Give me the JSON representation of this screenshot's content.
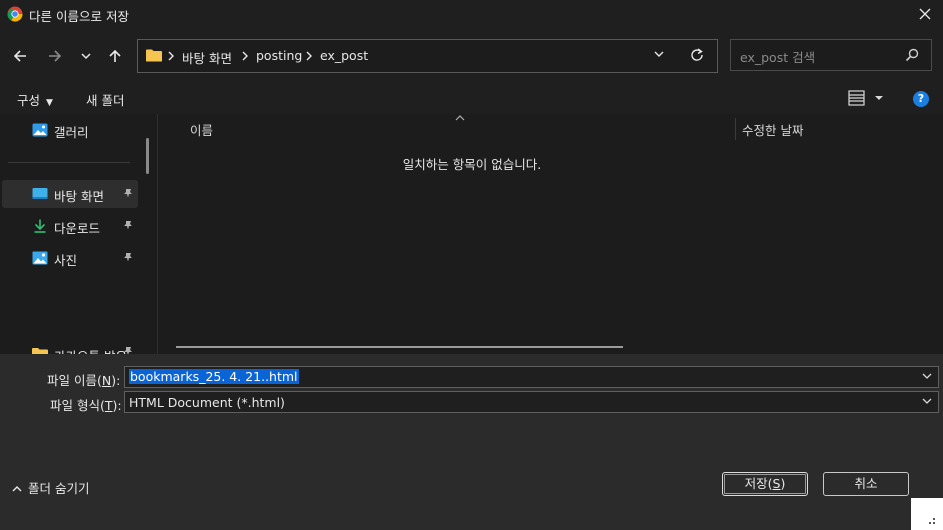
{
  "window": {
    "title": "다른 이름으로 저장"
  },
  "nav": {
    "address": {
      "crumbs": [
        "바탕 화면",
        "posting",
        "ex_post"
      ]
    },
    "search": {
      "placeholder": "ex_post 검색"
    }
  },
  "toolbar": {
    "organize_label": "구성",
    "new_folder_label": "새 폴더"
  },
  "sidebar": {
    "items": [
      {
        "label": "갤러리",
        "icon": "gallery-icon",
        "pinned": false
      },
      {
        "label": "바탕 화면",
        "icon": "desktop-icon",
        "pinned": true,
        "selected": true
      },
      {
        "label": "다운로드",
        "icon": "download-icon",
        "pinned": true
      },
      {
        "label": "사진",
        "icon": "pictures-icon",
        "pinned": true
      },
      {
        "label": "카카오톡 받은",
        "icon": "folder-icon",
        "pinned": false
      }
    ]
  },
  "list": {
    "columns": [
      "이름",
      "수정한 날짜"
    ],
    "empty_message": "일치하는 항목이 없습니다."
  },
  "form": {
    "filename_label_prefix": "파일 이름(",
    "filename_label_key": "N",
    "filename_label_suffix": "):",
    "filename_value": "bookmarks_25. 4. 21..html",
    "filetype_label_prefix": "파일 형식(",
    "filetype_label_key": "T",
    "filetype_label_suffix": "):",
    "filetype_value": "HTML Document (*.html)"
  },
  "footer": {
    "hide_folders_label": "폴더 숨기기",
    "save_label_prefix": "저장(",
    "save_label_key": "S",
    "save_label_suffix": ")",
    "cancel_label": "취소"
  },
  "colors": {
    "accent": "#0a64d6",
    "help": "#1a7fe0",
    "folder": "#f5c451"
  }
}
